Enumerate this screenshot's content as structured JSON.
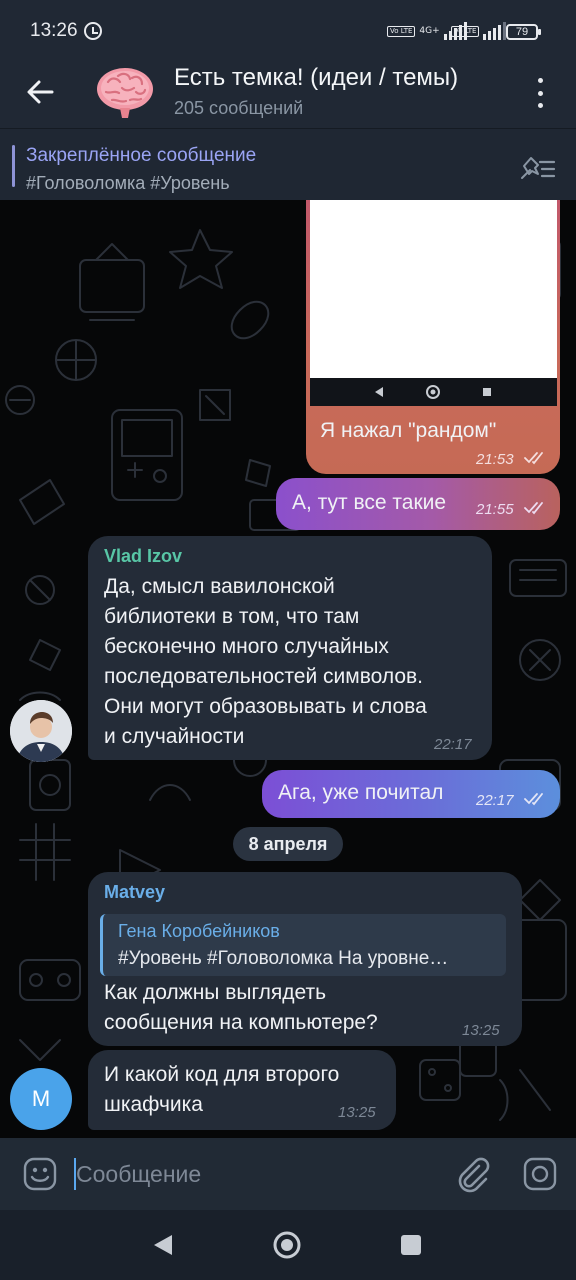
{
  "status_bar": {
    "time": "13:26",
    "battery": "79",
    "network_1": "4G+",
    "volte_label": "Vo LTE"
  },
  "header": {
    "title": "Есть темка! (идеи / темы)",
    "subtitle": "205 сообщений"
  },
  "pinned": {
    "title": "Закреплённое сообщение",
    "text": "#Головоломка #Уровень"
  },
  "messages": [
    {
      "direction": "out",
      "text": "Я нажал \"рандом\"",
      "time": "21:53",
      "has_image": true
    },
    {
      "direction": "out",
      "text": "А, тут все такие",
      "time": "21:55"
    },
    {
      "direction": "in",
      "sender": "Vlad Izov",
      "lines": [
        "Да, смысл вавилонской",
        "библиотеки в том, что там",
        "бесконечно много случайных",
        "последовательностей символов.",
        "Они могут образовывать и слова",
        "и случайности"
      ],
      "time": "22:17"
    },
    {
      "direction": "out",
      "text": "Ага, уже почитал",
      "time": "22:17"
    },
    {
      "direction": "in",
      "sender": "Matvey",
      "reply": {
        "author": "Гена Коробейников",
        "text": "#Уровень #Головоломка На уровне…"
      },
      "lines": [
        "Как должны выглядеть",
        "сообщения на компьютере?"
      ],
      "time": "13:25"
    },
    {
      "direction": "in",
      "sender": "Matvey",
      "avatar_letter": "M",
      "lines": [
        "И какой код для второго",
        "шкафчика"
      ],
      "time": "13:25"
    }
  ],
  "date_separator": "8 апреля",
  "composer": {
    "placeholder": "Сообщение"
  },
  "colors": {
    "incoming_bubble": "#242c38",
    "outgoing_gradient": [
      "#7a4fd0",
      "#c4574c",
      "#6a7bd8"
    ],
    "accent_green": "#58c6a6",
    "accent_blue": "#6aaee8"
  }
}
